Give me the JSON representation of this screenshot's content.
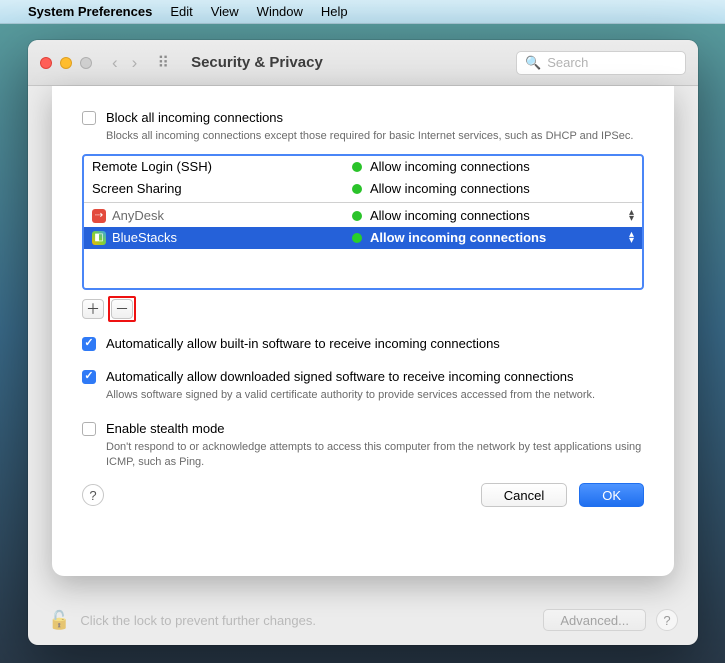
{
  "menubar": {
    "app": "System Preferences",
    "items": [
      "Edit",
      "View",
      "Window",
      "Help"
    ]
  },
  "window": {
    "title": "Security & Privacy",
    "search_placeholder": "Search"
  },
  "sheet": {
    "block_all": {
      "label": "Block all incoming connections",
      "desc": "Blocks all incoming connections except those required for basic Internet services, such as DHCP and IPSec."
    },
    "list": {
      "services": [
        {
          "name": "Remote Login (SSH)",
          "status": "Allow incoming connections"
        },
        {
          "name": "Screen Sharing",
          "status": "Allow incoming connections"
        }
      ],
      "apps": [
        {
          "name": "AnyDesk",
          "status": "Allow incoming connections",
          "icon": "red",
          "selected": false
        },
        {
          "name": "BlueStacks",
          "status": "Allow incoming connections",
          "icon": "multi",
          "selected": true
        }
      ]
    },
    "auto_builtin": {
      "label": "Automatically allow built-in software to receive incoming connections"
    },
    "auto_signed": {
      "label": "Automatically allow downloaded signed software to receive incoming connections",
      "desc": "Allows software signed by a valid certificate authority to provide services accessed from the network."
    },
    "stealth": {
      "label": "Enable stealth mode",
      "desc": "Don't respond to or acknowledge attempts to access this computer from the network by test applications using ICMP, such as Ping."
    },
    "buttons": {
      "cancel": "Cancel",
      "ok": "OK"
    }
  },
  "footer": {
    "lock_text": "Click the lock to prevent further changes.",
    "advanced": "Advanced..."
  }
}
